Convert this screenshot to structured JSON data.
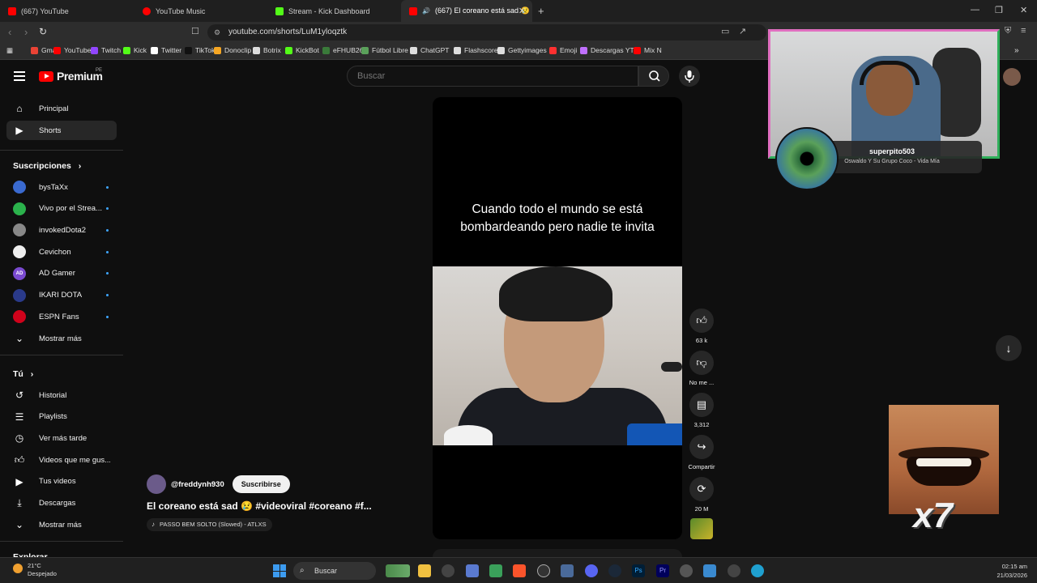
{
  "browser": {
    "tabs": [
      {
        "label": "(667) YouTube",
        "color": "#ff0000"
      },
      {
        "label": "YouTube Music",
        "color": "#ff0000"
      },
      {
        "label": "Stream - Kick Dashboard",
        "color": "#53fc18"
      },
      {
        "label": "(667) El coreano está sad 😢",
        "color": "#ff0000",
        "active": true
      }
    ],
    "url": "youtube.com/shorts/LuM1yloqztk",
    "bookmarks": [
      {
        "label": "Gmail",
        "color": "#ea4335"
      },
      {
        "label": "YouTube",
        "color": "#ff0000"
      },
      {
        "label": "Twitch",
        "color": "#9146ff"
      },
      {
        "label": "Kick",
        "color": "#53fc18"
      },
      {
        "label": "Twitter",
        "color": "#ffffff"
      },
      {
        "label": "TikTok",
        "color": "#111111"
      },
      {
        "label": "Donoclip",
        "color": "#f5a623"
      },
      {
        "label": "Botrix",
        "color": "#dddddd"
      },
      {
        "label": "KickBot",
        "color": "#53fc18"
      },
      {
        "label": "eFHUB26",
        "color": "#3a7a3a"
      },
      {
        "label": "Fútbol Libre",
        "color": "#5aa05a"
      },
      {
        "label": "ChatGPT",
        "color": "#dddddd"
      },
      {
        "label": "Flashscore",
        "color": "#dddddd"
      },
      {
        "label": "Gettyimages",
        "color": "#dddddd"
      },
      {
        "label": "Emoji",
        "color": "#ff3030"
      },
      {
        "label": "Descargas YT",
        "color": "#c070ff"
      },
      {
        "label": "Mix N",
        "color": "#ff0000"
      }
    ]
  },
  "header": {
    "logo_text": "Premium",
    "logo_region": "PE",
    "search_placeholder": "Buscar"
  },
  "sidebar": {
    "main": [
      {
        "label": "Principal",
        "icon": "home-icon"
      },
      {
        "label": "Shorts",
        "icon": "shorts-icon",
        "active": true
      }
    ],
    "subscriptions_title": "Suscripciones",
    "subscriptions": [
      {
        "label": "bysTaXx",
        "color": "#3a6ad0",
        "initials": ""
      },
      {
        "label": "Vivo por el Strea...",
        "color": "#2bb24c",
        "initials": ""
      },
      {
        "label": "invokedDota2",
        "color": "#888888",
        "initials": ""
      },
      {
        "label": "Cevichon",
        "color": "#eeeeee",
        "initials": ""
      },
      {
        "label": "AD Gamer",
        "color": "#7a4ad0",
        "initials": "AD"
      },
      {
        "label": "IKARI DOTA",
        "color": "#2a3a8a",
        "initials": ""
      },
      {
        "label": "ESPN Fans",
        "color": "#d0021b",
        "initials": ""
      }
    ],
    "more_subs": "Mostrar más",
    "you_title": "Tú",
    "you_items": [
      {
        "label": "Historial",
        "icon": "history-icon"
      },
      {
        "label": "Playlists",
        "icon": "playlists-icon"
      },
      {
        "label": "Ver más tarde",
        "icon": "watch-later-icon"
      },
      {
        "label": "Videos que me gus...",
        "icon": "liked-icon"
      },
      {
        "label": "Tus videos",
        "icon": "your-videos-icon"
      },
      {
        "label": "Descargas",
        "icon": "downloads-icon"
      }
    ],
    "more_you": "Mostrar más",
    "explore_title": "Explorar"
  },
  "short": {
    "caption": "Cuando todo el mundo se está bombardeando pero nadie te invita",
    "channel": "@freddynh930",
    "subscribe_label": "Suscribirse",
    "title": "El coreano está sad 😢 #videoviral #coreano #f...",
    "music": "PASSO BEM SOLTO (Slowed) - ATLXS"
  },
  "actions": [
    {
      "name": "like",
      "count": "63 k"
    },
    {
      "name": "dislike",
      "count": "No me ..."
    },
    {
      "name": "comments",
      "count": "3,312"
    },
    {
      "name": "share",
      "count": "Compartir"
    },
    {
      "name": "remix",
      "count": "20 M"
    }
  ],
  "overlay": {
    "stream_user": "superpito503",
    "now_playing": "Oswaldo Y Su Grupo Coco - Vida Mía",
    "meme_multiplier": "x7"
  },
  "taskbar": {
    "temp": "21°C",
    "weather": "Despejado",
    "search_label": "Buscar",
    "time": "02:15 am",
    "date": "21/03/2026"
  }
}
